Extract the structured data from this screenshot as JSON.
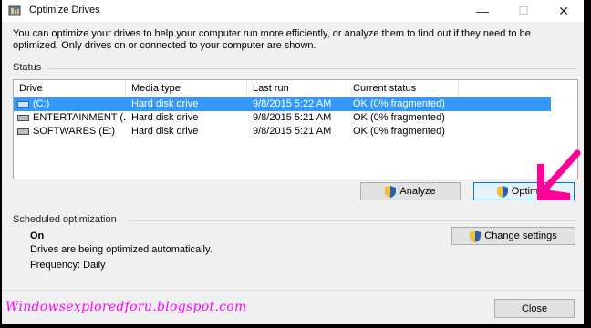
{
  "window": {
    "title": "Optimize Drives",
    "controls": {
      "minimize": "—",
      "maximize": "☐",
      "close": "✕"
    }
  },
  "intro_text": "You can optimize your drives to help your computer run more efficiently, or analyze them to find out if they need to be optimized. Only drives on or connected to your computer are shown.",
  "status": {
    "label": "Status",
    "columns": [
      "Drive",
      "Media type",
      "Last run",
      "Current status"
    ],
    "rows": [
      {
        "drive": "(C:)",
        "media_type": "Hard disk drive",
        "last_run": "9/8/2015 5:22 AM",
        "current_status": "OK (0% fragmented)",
        "selected": true,
        "icon": "system-drive-icon"
      },
      {
        "drive": "ENTERTAINMENT (...",
        "media_type": "Hard disk drive",
        "last_run": "9/8/2015 5:21 AM",
        "current_status": "OK (0% fragmented)",
        "selected": false,
        "icon": "hard-drive-icon"
      },
      {
        "drive": "SOFTWARES (E:)",
        "media_type": "Hard disk drive",
        "last_run": "9/8/2015 5:21 AM",
        "current_status": "OK (0% fragmented)",
        "selected": false,
        "icon": "hard-drive-icon"
      }
    ],
    "analyze_label": "Analyze",
    "optimize_label": "Optimize"
  },
  "scheduled": {
    "label": "Scheduled optimization",
    "state": "On",
    "description": "Drives are being optimized automatically.",
    "frequency": "Frequency: Daily",
    "change_settings_label": "Change settings"
  },
  "footer": {
    "close_label": "Close",
    "watermark": "Windowsexploredforu.blogspot.com"
  },
  "colors": {
    "selection": "#3399ff",
    "annotation_arrow": "#ff0099",
    "watermark": "#ff00ff"
  }
}
